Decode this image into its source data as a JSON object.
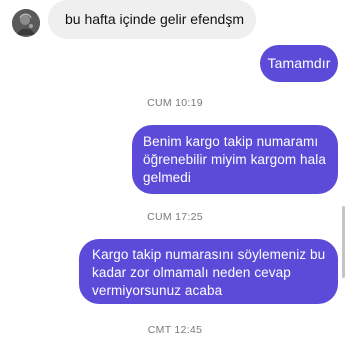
{
  "conversation": {
    "messages": [
      {
        "from": "contact",
        "text": "bu hafta içinde gelir efendşm"
      },
      {
        "from": "me",
        "text": "Tamamdır"
      },
      {
        "from": "me",
        "text": "Benim kargo takip numaramı öğrenebilir miyim kargom hala gelmedi"
      },
      {
        "from": "me",
        "text": "Kargo takip numarasını söylemeniz bu kadar zor olmamalı neden cevap vermiyorsunuz acaba"
      }
    ],
    "timestamps": [
      "CUM 10:19",
      "CUM 17:25",
      "CMT 12:45"
    ]
  },
  "colors": {
    "outgoing_bubble": "#5b4bd8",
    "incoming_bubble": "#efefef",
    "timestamp_text": "#7a7a7a"
  },
  "icons": {
    "avatar": "contact-avatar"
  }
}
